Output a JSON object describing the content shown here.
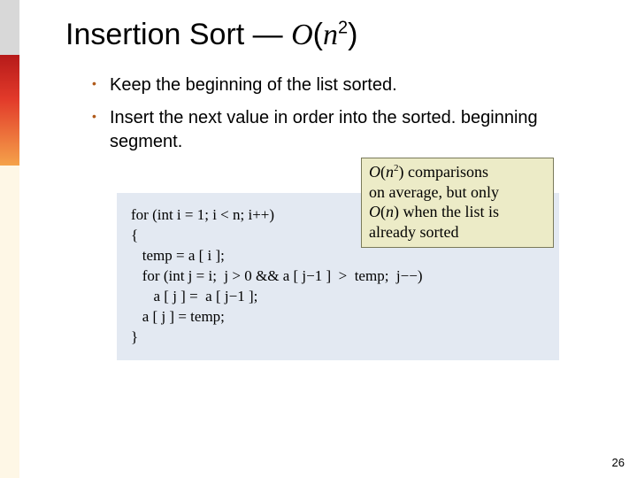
{
  "title": {
    "prefix": "Insertion Sort — ",
    "bigO_O": "O",
    "bigO_open": "(",
    "bigO_var": "n",
    "bigO_exp": "2",
    "bigO_close": ")"
  },
  "bullets": [
    "Keep the beginning of the list sorted.",
    "Insert the next value in order into the sorted. beginning segment."
  ],
  "note": {
    "line1_a": "O",
    "line1_b": "(",
    "line1_c": "n",
    "line1_d": "2",
    "line1_e": ") comparisons",
    "line2": "on average, but only",
    "line3_a": "O",
    "line3_b": "(",
    "line3_c": "n",
    "line3_d": ") when the list is",
    "line4": "already sorted"
  },
  "code": "for (int i = 1; i < n; i++)\n{\n   temp = a [ i ];\n   for (int j = i;  j > 0 && a [ j−1 ]  >  temp;  j−−)\n      a [ j ] =  a [ j−1 ];\n   a [ j ] = temp;\n}",
  "pagenum": "26"
}
